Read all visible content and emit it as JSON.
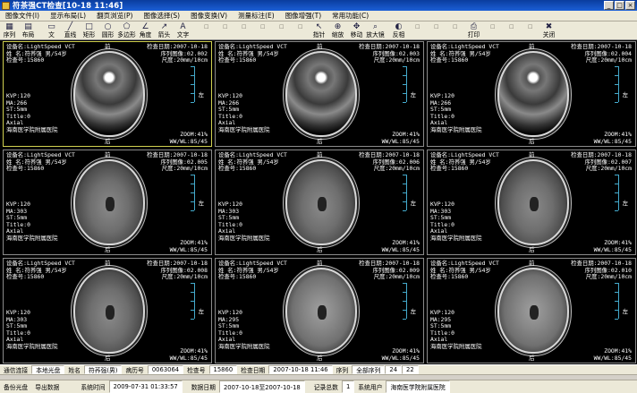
{
  "window": {
    "title": "符茶强CT检查[10-18 11:46]",
    "btn_min": "_",
    "btn_max": "□",
    "btn_close": "×"
  },
  "menu": [
    "图像文件(I)",
    "显示布局(L)",
    "翻页浏览(P)",
    "图像选择(S)",
    "图像变换(V)",
    "测量标注(E)",
    "图像增强(T)",
    "常用功能(C)"
  ],
  "toolbar": {
    "items": [
      {
        "label": "序列",
        "icon": "grid-icon"
      },
      {
        "label": "布局",
        "icon": "layout-icon"
      },
      {
        "label": "",
        "icon": "sep"
      },
      {
        "label": "文",
        "icon": "text-icon"
      },
      {
        "label": "直线",
        "icon": "line-icon"
      },
      {
        "label": "矩形",
        "icon": "rect-icon"
      },
      {
        "label": "圆形",
        "icon": "circle-icon"
      },
      {
        "label": "多边形",
        "icon": "polygon-icon"
      },
      {
        "label": "角度",
        "icon": "angle-icon"
      },
      {
        "label": "箭头",
        "icon": "arrow-icon"
      },
      {
        "label": "文字",
        "icon": "letter-icon"
      },
      {
        "label": "",
        "icon": "sep"
      },
      {
        "label": "",
        "icon": "blank"
      },
      {
        "label": "",
        "icon": "blank"
      },
      {
        "label": "",
        "icon": "blank"
      },
      {
        "label": "",
        "icon": "blank"
      },
      {
        "label": "",
        "icon": "blank"
      },
      {
        "label": "",
        "icon": "blank"
      },
      {
        "label": "指针",
        "icon": "pointer-icon"
      },
      {
        "label": "缩放",
        "icon": "zoom-icon"
      },
      {
        "label": "移动",
        "icon": "move-icon"
      },
      {
        "label": "放大镜",
        "icon": "magnifier-icon"
      },
      {
        "label": "",
        "icon": "sep"
      },
      {
        "label": "反相",
        "icon": "invert-icon"
      },
      {
        "label": "",
        "icon": "blank"
      },
      {
        "label": "",
        "icon": "blank"
      },
      {
        "label": "",
        "icon": "blank"
      },
      {
        "label": "打印",
        "icon": "print-icon"
      },
      {
        "label": "",
        "icon": "blank"
      },
      {
        "label": "",
        "icon": "blank"
      },
      {
        "label": "",
        "icon": "blank"
      },
      {
        "label": "关闭",
        "icon": "close-icon"
      }
    ]
  },
  "overlay": {
    "device": "设备名:LightSpeed VCT",
    "check_date": "检查日期:2007-10-18",
    "patient": "姓  名:符荞强  男/54岁",
    "exam_no": "检查号:15860",
    "thickness": "尺度:20mm/10cm",
    "front": "前",
    "back": "后",
    "left": "左",
    "hospital": "海南医学院附属医院",
    "title": "Title:0",
    "axial": "Axial",
    "st": "ST:5mm",
    "zoom": "ZOOM:41%",
    "window": "WW/WL:85/45"
  },
  "tiles": [
    {
      "seq": "序列图像:02.002",
      "kvp": "KVP:120",
      "ma": "MA:266",
      "type": "base"
    },
    {
      "seq": "序列图像:02.003",
      "kvp": "KVP:120",
      "ma": "MA:266",
      "type": "base"
    },
    {
      "seq": "序列图像:02.004",
      "kvp": "KVP:120",
      "ma": "MA:266",
      "type": "base"
    },
    {
      "seq": "序列图像:02.005",
      "kvp": "KVP:120",
      "ma": "MA:303",
      "type": "mid"
    },
    {
      "seq": "序列图像:02.006",
      "kvp": "KVP:120",
      "ma": "MA:303",
      "type": "mid"
    },
    {
      "seq": "序列图像:02.007",
      "kvp": "KVP:120",
      "ma": "MA:303",
      "type": "mid"
    },
    {
      "seq": "序列图像:02.008",
      "kvp": "KVP:120",
      "ma": "MA:303",
      "type": "mid"
    },
    {
      "seq": "序列图像:02.009",
      "kvp": "KVP:120",
      "ma": "MA:295",
      "type": "high"
    },
    {
      "seq": "序列图像:02.010",
      "kvp": "KVP:120",
      "ma": "MA:295",
      "type": "high"
    }
  ],
  "status1": {
    "conn_label": "通信连接",
    "conn_value": "本地光盘",
    "name_label": "姓名",
    "name_value": "符荞强(男)",
    "record_label": "病历号",
    "record_value": "0063064",
    "exam_label": "检查号",
    "exam_value": "15860",
    "date_label": "检查日期",
    "date_value": "2007-10-18 11:46",
    "seq_label": "序列",
    "seq_value": "全部序列",
    "count1": "24",
    "count2": "22"
  },
  "status2": {
    "backup": "备份光盘",
    "export": "导出数据",
    "systime_label": "系统时间",
    "systime_value": "2009-07-31 01:33:57",
    "range_label": "数据日期",
    "range_value": "2007-10-18至2007-10-18",
    "total_label": "记录总数",
    "total_value": "1",
    "user_label": "系统用户",
    "user_value": "海南医学院附属医院"
  }
}
